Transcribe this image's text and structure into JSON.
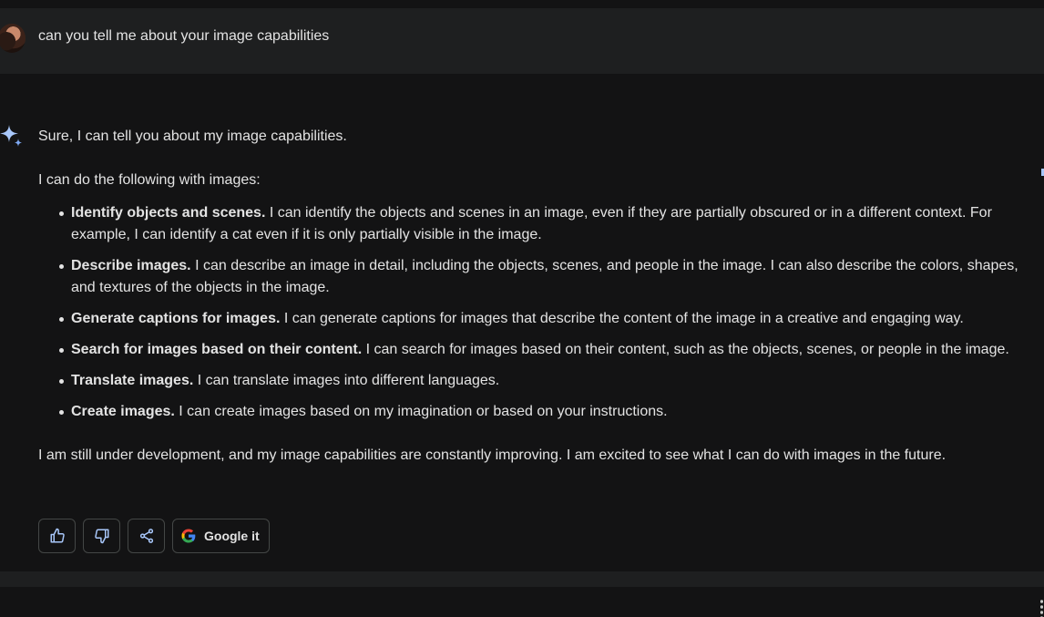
{
  "prompt": {
    "text": "can you tell me about your image capabilities"
  },
  "response": {
    "intro": "Sure, I can tell you about my image capabilities.",
    "lead": "I can do the following with images:",
    "items": [
      {
        "title": "Identify objects and scenes.",
        "body": " I can identify the objects and scenes in an image, even if they are partially obscured or in a different context. For example, I can identify a cat even if it is only partially visible in the image."
      },
      {
        "title": "Describe images.",
        "body": " I can describe an image in detail, including the objects, scenes, and people in the image. I can also describe the colors, shapes, and textures of the objects in the image."
      },
      {
        "title": "Generate captions for images.",
        "body": " I can generate captions for images that describe the content of the image in a creative and engaging way."
      },
      {
        "title": "Search for images based on their content.",
        "body": " I can search for images based on their content, such as the objects, scenes, or people in the image."
      },
      {
        "title": "Translate images.",
        "body": " I can translate images into different languages."
      },
      {
        "title": "Create images.",
        "body": " I can create images based on my imagination or based on your instructions."
      }
    ],
    "outro": "I am still under development, and my image capabilities are constantly improving. I am excited to see what I can do with images in the future."
  },
  "actions": {
    "google_label": "Google it"
  },
  "icons": {
    "thumbs_up": "thumb-up-icon",
    "thumbs_down": "thumb-down-icon",
    "share": "share-icon",
    "google": "google-g-icon",
    "sparkle": "gemini-sparkle-icon"
  },
  "colors": {
    "background": "#131314",
    "prompt_bar": "#1e1f20",
    "text": "#e3e3e3",
    "border": "#444746",
    "sparkle": "#a8c7fa"
  }
}
